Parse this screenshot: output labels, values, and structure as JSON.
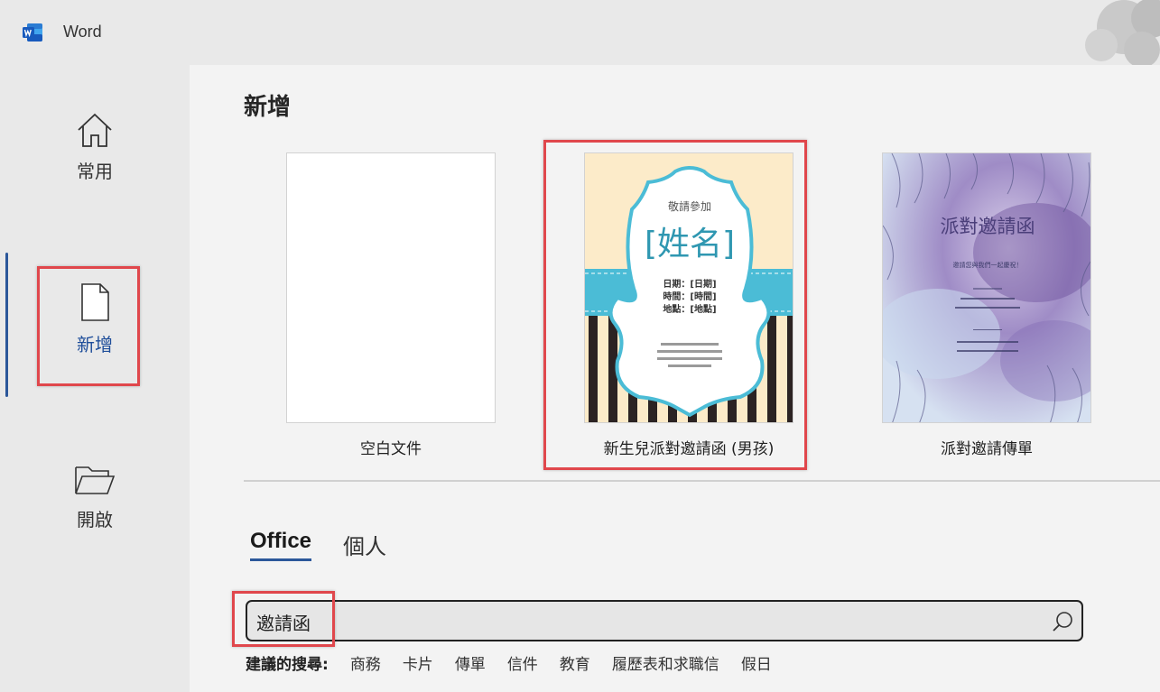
{
  "app": {
    "title": "Word"
  },
  "nav": {
    "home": "常用",
    "new": "新增",
    "open": "開啟"
  },
  "main": {
    "title": "新增",
    "templates": [
      {
        "name": "空白文件"
      },
      {
        "name": "新生兒派對邀請函 (男孩)",
        "thumb": {
          "invite": "敬請參加",
          "name": "[姓名]",
          "line1": "日期：[日期]",
          "line2": "時間：[時間]",
          "line3": "地點：[地點]"
        }
      },
      {
        "name": "派對邀請傳單",
        "thumb": {
          "title": "派對邀請函",
          "subtitle": "邀請您與我們一起慶祝！"
        }
      }
    ],
    "tabs": {
      "office": "Office",
      "personal": "個人"
    },
    "search": {
      "value": "邀請函"
    },
    "suggested": {
      "label": "建議的搜尋:",
      "items": [
        "商務",
        "卡片",
        "傳單",
        "信件",
        "教育",
        "履歷表和求職信",
        "假日"
      ]
    }
  },
  "colors": {
    "accent": "#2b579a",
    "highlight": "#e0474c",
    "baby_teal": "#4bbcd6",
    "baby_cream": "#fcebc9",
    "party_purple": "#7a62a8"
  }
}
